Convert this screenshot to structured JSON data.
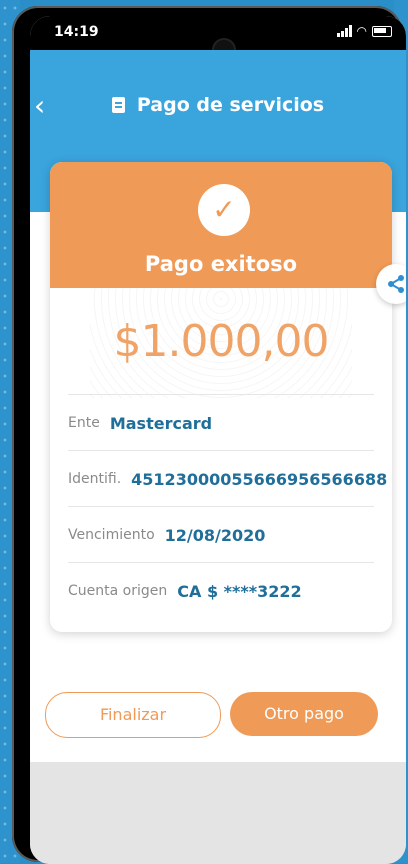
{
  "status": {
    "time": "14:19"
  },
  "header": {
    "title": "Pago de servicios"
  },
  "receipt": {
    "status_text": "Pago exitoso",
    "amount": "$1.000,00",
    "rows": [
      {
        "label": "Ente",
        "value": "Mastercard"
      },
      {
        "label": "Identifi.",
        "value": "45123000055666956566688"
      },
      {
        "label": "Vencimiento",
        "value": "12/08/2020"
      },
      {
        "label": "Cuenta origen",
        "value": "CA $ ****3222"
      }
    ]
  },
  "actions": {
    "finalize": "Finalizar",
    "another_payment": "Otro pago"
  },
  "colors": {
    "blue": "#3aa4dc",
    "orange": "#ef9a56",
    "value_text": "#1f6f9a"
  },
  "icons": {
    "back": "chevron-left-icon",
    "doc": "document-icon",
    "check": "check-icon",
    "share": "share-icon"
  }
}
